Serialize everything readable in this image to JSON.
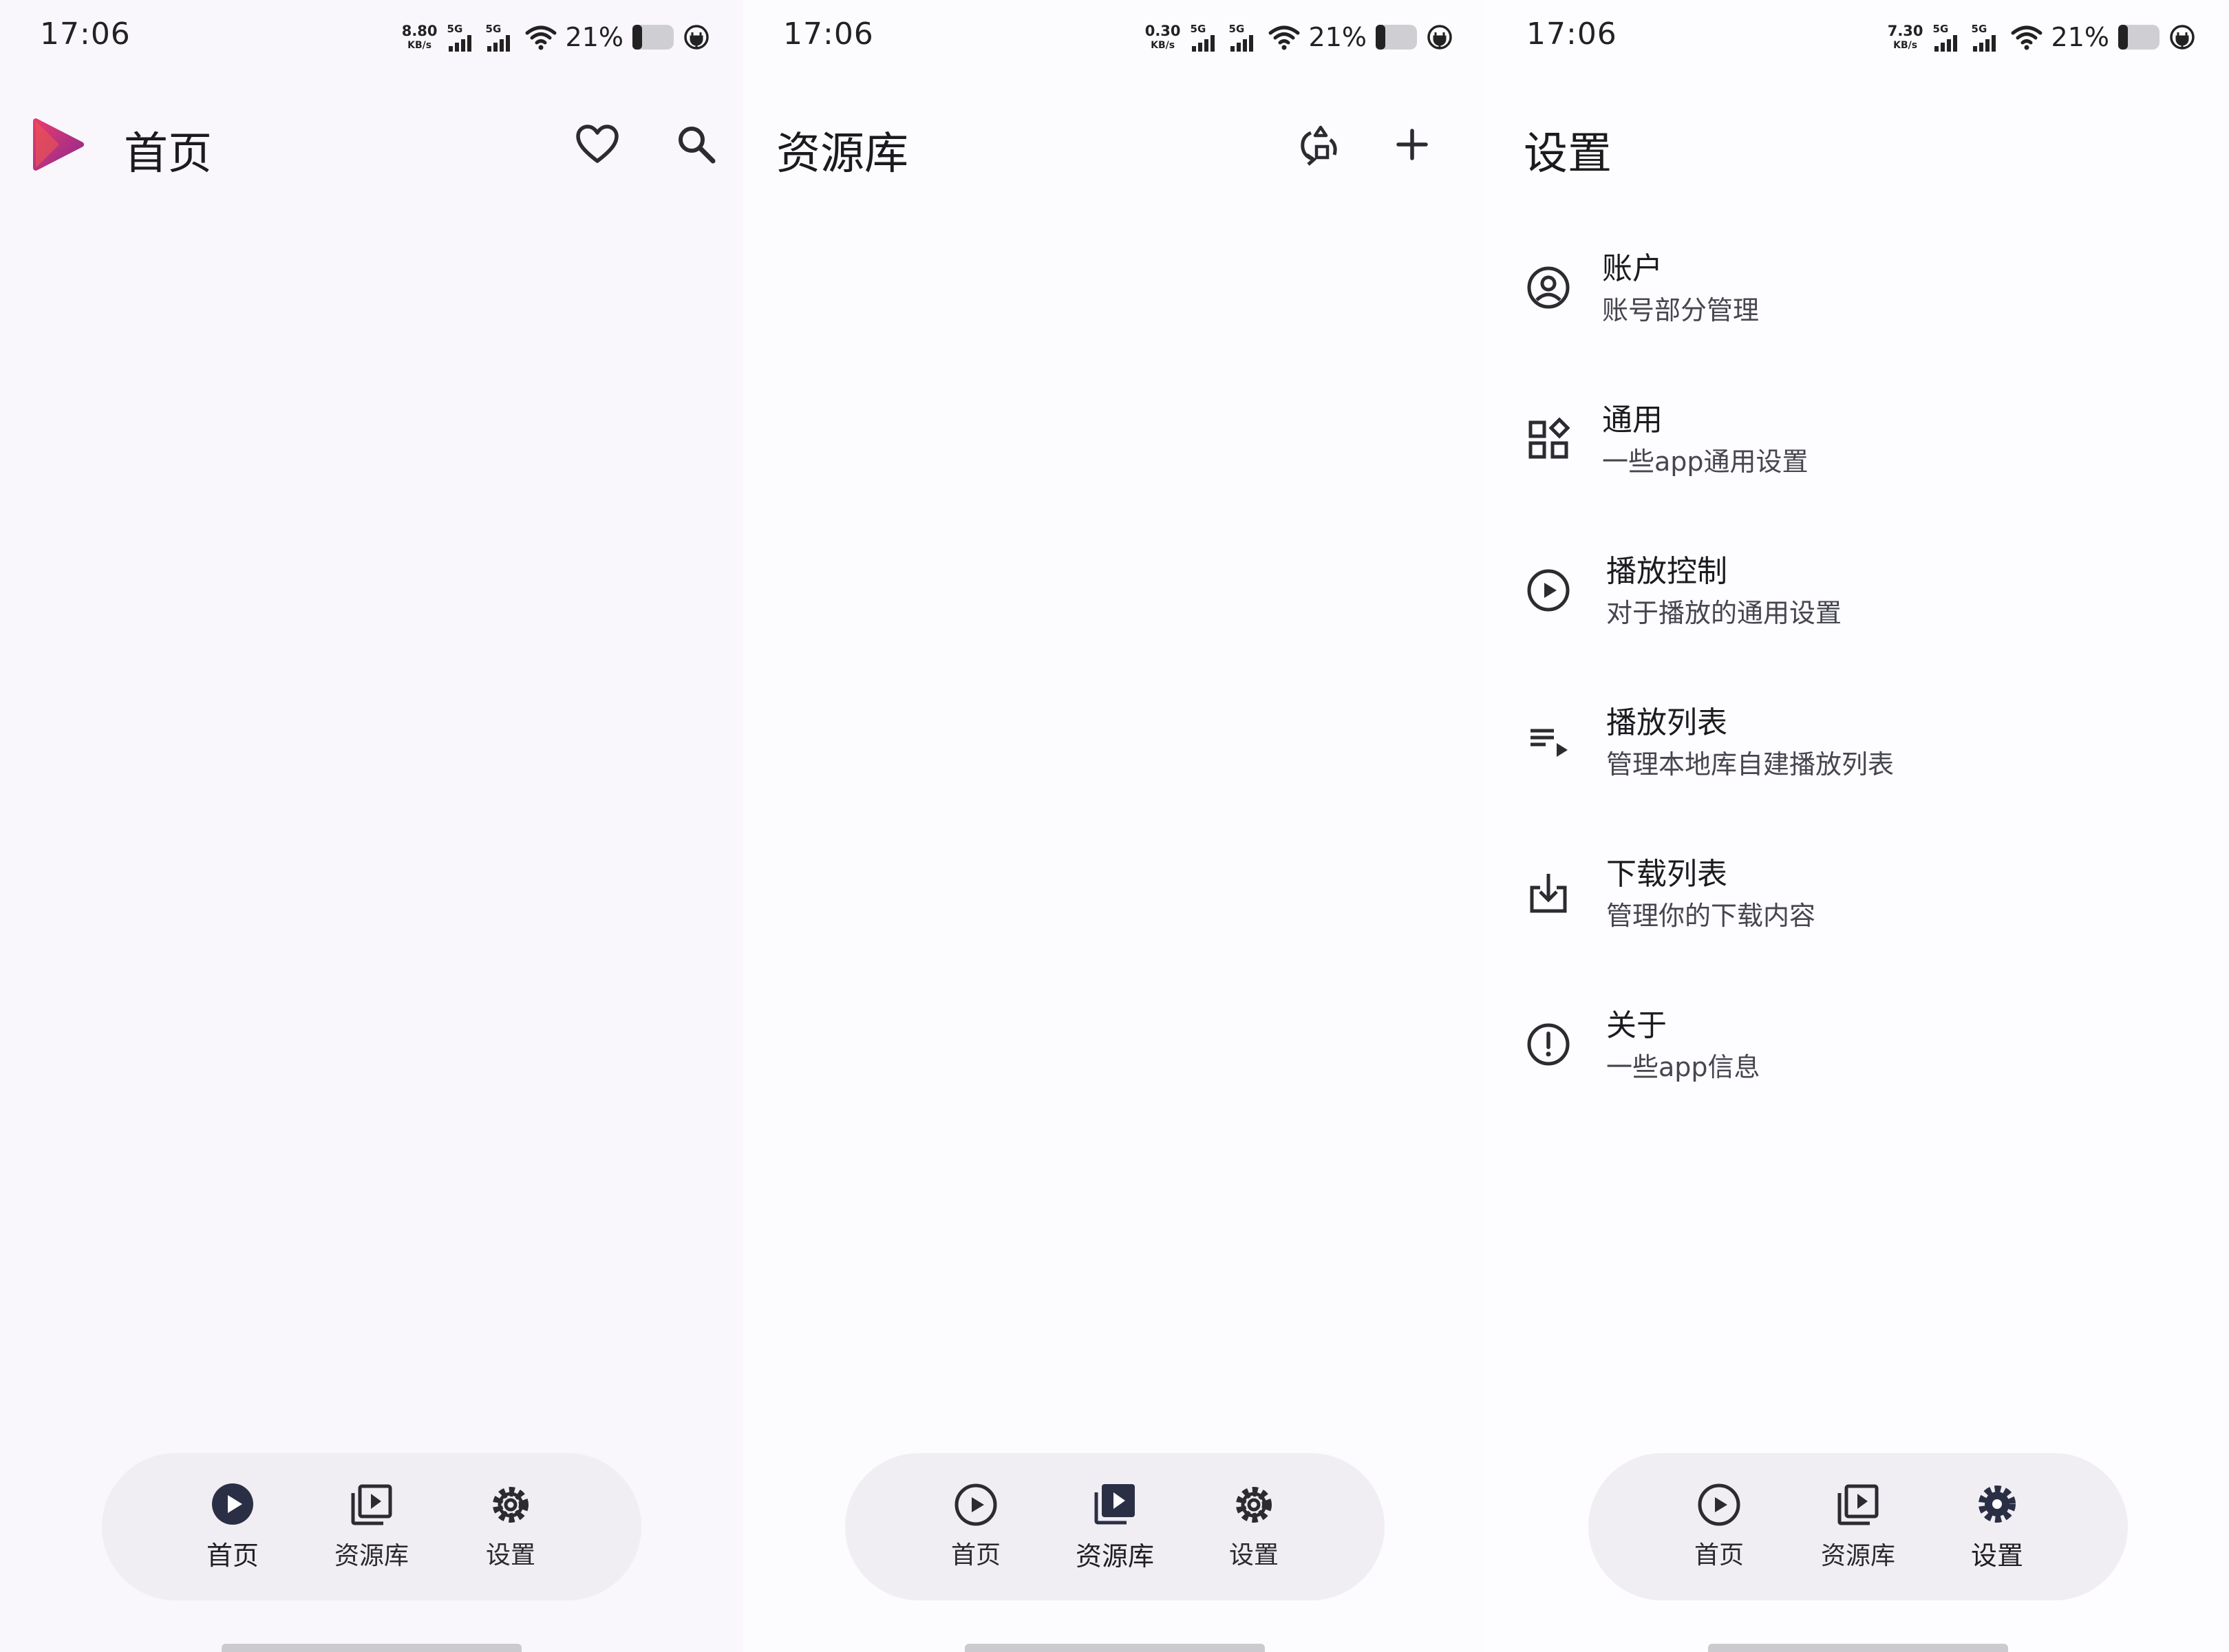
{
  "screens": [
    {
      "status": {
        "time": "17:06",
        "speed": "8.80",
        "speed_unit": "KB/s",
        "sim1": "5G",
        "sim2": "5G",
        "battery": "21%"
      },
      "title": "首页",
      "actions": [
        "favorite-icon",
        "search-icon"
      ]
    },
    {
      "status": {
        "time": "17:06",
        "speed": "0.30",
        "speed_unit": "KB/s",
        "sim1": "5G",
        "sim2": "5G",
        "battery": "21%"
      },
      "title": "资源库",
      "actions": [
        "sync-icon",
        "add-icon"
      ]
    },
    {
      "status": {
        "time": "17:06",
        "speed": "7.30",
        "speed_unit": "KB/s",
        "sim1": "5G",
        "sim2": "5G",
        "battery": "21%"
      },
      "title": "设置",
      "items": [
        {
          "icon": "account-circle-icon",
          "title": "账户",
          "subtitle": "账号部分管理"
        },
        {
          "icon": "widgets-icon",
          "title": "通用",
          "subtitle": "一些app通用设置"
        },
        {
          "icon": "play-circle-icon",
          "title": "播放控制",
          "subtitle": "对于播放的通用设置"
        },
        {
          "icon": "playlist-play-icon",
          "title": "播放列表",
          "subtitle": "管理本地库自建播放列表"
        },
        {
          "icon": "download-icon",
          "title": "下载列表",
          "subtitle": "管理你的下载内容"
        },
        {
          "icon": "info-icon",
          "title": "关于",
          "subtitle": "一些app信息"
        }
      ]
    }
  ],
  "nav": {
    "items": [
      "首页",
      "资源库",
      "设置"
    ]
  },
  "colors": {
    "background": "#fbf9fd",
    "nav_background": "#f0eef3",
    "icon": "#2b2b30",
    "logo_start": "#e63b6f",
    "logo_end": "#8e2a8f"
  }
}
